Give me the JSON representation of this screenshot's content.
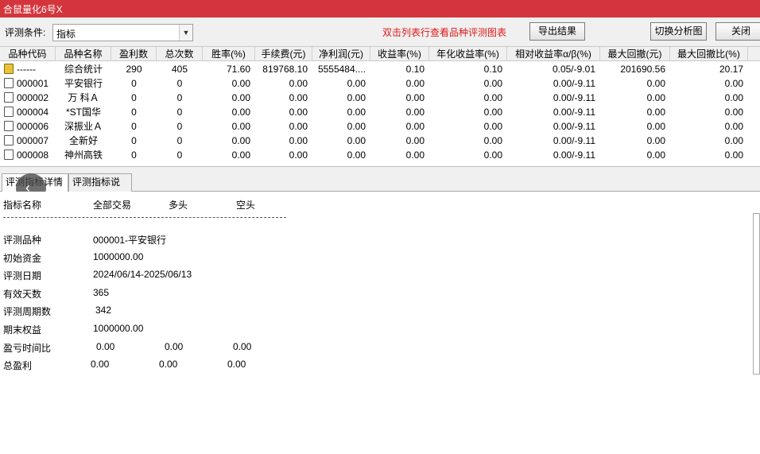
{
  "window": {
    "title": "合鼠量化6号X"
  },
  "toolbar": {
    "condition_label": "评测条件:",
    "condition_value": "指标",
    "hint": "双击列表行查看品种评测图表",
    "export_label": "导出结果",
    "switch_label": "切换分析图",
    "close_label": "关闭"
  },
  "grid": {
    "headers": [
      "品种代码",
      "品种名称",
      "盈利数",
      "总次数",
      "胜率(%)",
      "手续费(元)",
      "净利润(元)",
      "收益率(%)",
      "年化收益率(%)",
      "相对收益率α/β(%)",
      "最大回撤(元)",
      "最大回撤比(%)"
    ],
    "rows": [
      {
        "code": "------",
        "name": "综合统计",
        "profit_count": "290",
        "total": "405",
        "win_rate": "71.60",
        "fee": "819768.10",
        "net": "5555484....",
        "ret": "0.10",
        "annual": "0.10",
        "alpha_beta": "0.05/-9.01",
        "max_dd": "201690.56",
        "max_dd_ratio": "20.17"
      },
      {
        "code": "000001",
        "name": "平安银行",
        "profit_count": "0",
        "total": "0",
        "win_rate": "0.00",
        "fee": "0.00",
        "net": "0.00",
        "ret": "0.00",
        "annual": "0.00",
        "alpha_beta": "0.00/-9.11",
        "max_dd": "0.00",
        "max_dd_ratio": "0.00"
      },
      {
        "code": "000002",
        "name": "万 科Ａ",
        "profit_count": "0",
        "total": "0",
        "win_rate": "0.00",
        "fee": "0.00",
        "net": "0.00",
        "ret": "0.00",
        "annual": "0.00",
        "alpha_beta": "0.00/-9.11",
        "max_dd": "0.00",
        "max_dd_ratio": "0.00"
      },
      {
        "code": "000004",
        "name": "*ST国华",
        "profit_count": "0",
        "total": "0",
        "win_rate": "0.00",
        "fee": "0.00",
        "net": "0.00",
        "ret": "0.00",
        "annual": "0.00",
        "alpha_beta": "0.00/-9.11",
        "max_dd": "0.00",
        "max_dd_ratio": "0.00"
      },
      {
        "code": "000006",
        "name": "深振业Ａ",
        "profit_count": "0",
        "total": "0",
        "win_rate": "0.00",
        "fee": "0.00",
        "net": "0.00",
        "ret": "0.00",
        "annual": "0.00",
        "alpha_beta": "0.00/-9.11",
        "max_dd": "0.00",
        "max_dd_ratio": "0.00"
      },
      {
        "code": "000007",
        "name": "全新好",
        "profit_count": "0",
        "total": "0",
        "win_rate": "0.00",
        "fee": "0.00",
        "net": "0.00",
        "ret": "0.00",
        "annual": "0.00",
        "alpha_beta": "0.00/-9.11",
        "max_dd": "0.00",
        "max_dd_ratio": "0.00"
      },
      {
        "code": "000008",
        "name": "神州高铁",
        "profit_count": "0",
        "total": "0",
        "win_rate": "0.00",
        "fee": "0.00",
        "net": "0.00",
        "ret": "0.00",
        "annual": "0.00",
        "alpha_beta": "0.00/-9.11",
        "max_dd": "0.00",
        "max_dd_ratio": "0.00"
      }
    ]
  },
  "tabs": {
    "detail_label": "评测指标详情",
    "desc_label": "评测指标说明"
  },
  "detail": {
    "header": {
      "name": "指标名称",
      "all": "全部交易",
      "long": "多头",
      "short": "空头"
    },
    "dashes": "-------------------------------------------------------------------------------",
    "rows": [
      {
        "label": "评测品种",
        "v1": "000001-平安银行",
        "v2": "",
        "v3": ""
      },
      {
        "label": "初始资金",
        "v1": "1000000.00",
        "v2": "",
        "v3": ""
      },
      {
        "label": "评测日期",
        "v1": "2024/06/14-2025/06/13",
        "v2": "",
        "v3": ""
      },
      {
        "label": "有效天数",
        "v1": "365",
        "v2": "",
        "v3": ""
      },
      {
        "label": "评测周期数",
        "v1": "342",
        "v2": "",
        "v3": ""
      },
      {
        "label": "期末权益",
        "v1": "1000000.00",
        "v2": "",
        "v3": ""
      },
      {
        "label": "盈亏时间比",
        "v1": "0.00",
        "v2": "0.00",
        "v3": "0.00"
      },
      {
        "label": "总盈利",
        "v1": "0.00",
        "v2": "0.00",
        "v3": "0.00"
      }
    ]
  },
  "icons": {
    "row_icon": "document-icon",
    "summary_icon": "folder-icon",
    "back_icon": "chevron-left-icon"
  },
  "colors": {
    "titlebar": "#d4353c",
    "hint": "#e01818"
  }
}
